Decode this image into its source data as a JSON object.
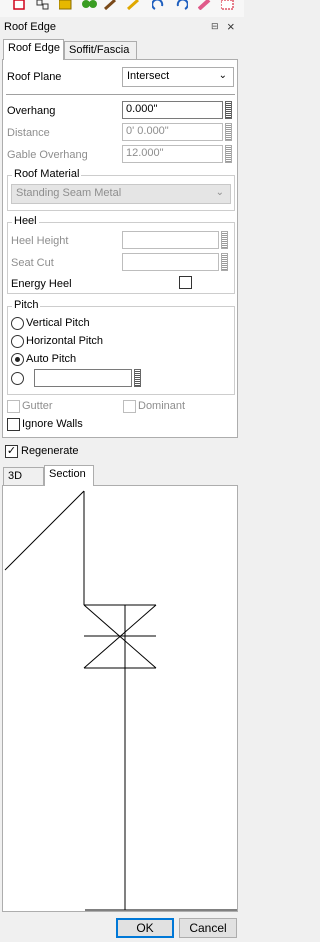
{
  "toolbar": {
    "icons": [
      "new-file-icon",
      "nodes-icon",
      "folder-lock-icon",
      "trees-icon",
      "brush-icon",
      "pencil-icon",
      "undo-icon",
      "redo-icon",
      "eraser-icon",
      "grid-icon"
    ]
  },
  "window": {
    "title": "Roof Edge",
    "pin_glyph": "⊟",
    "close_glyph": "×"
  },
  "tabs_top": [
    {
      "label": "Roof Edge",
      "active": true
    },
    {
      "label": "Soffit/Fascia",
      "active": false
    }
  ],
  "form": {
    "roof_plane_label": "Roof Plane",
    "roof_plane_value": "Intersect",
    "overhang_label": "Overhang",
    "overhang_value": "0.000\"",
    "distance_label": "Distance",
    "distance_value": "0' 0.000\"",
    "gable_overhang_label": "Gable Overhang",
    "gable_overhang_value": "12.000\""
  },
  "roof_material": {
    "title": "Roof Material",
    "value": "Standing Seam Metal"
  },
  "heel": {
    "title": "Heel",
    "heel_height_label": "Heel Height",
    "heel_height_value": "",
    "seat_cut_label": "Seat Cut",
    "seat_cut_value": "",
    "energy_heel_label": "Energy Heel",
    "energy_heel_checked": false
  },
  "pitch": {
    "title": "Pitch",
    "options": [
      {
        "label": "Vertical Pitch",
        "selected": false
      },
      {
        "label": "Horizontal Pitch",
        "selected": false
      },
      {
        "label": "Auto Pitch",
        "selected": true
      }
    ],
    "custom_value": ""
  },
  "checks": {
    "gutter_label": "Gutter",
    "gutter_checked": false,
    "dominant_label": "Dominant",
    "dominant_checked": false,
    "ignore_walls_label": "Ignore Walls",
    "ignore_walls_checked": false
  },
  "regenerate": {
    "label": "Regenerate",
    "checked": true,
    "check_glyph": "✓"
  },
  "tabs_bottom": [
    {
      "label": "3D",
      "active": false
    },
    {
      "label": "Section",
      "active": true
    }
  ],
  "buttons": {
    "ok": "OK",
    "cancel": "Cancel"
  },
  "glyphs": {
    "chevron": "⌄"
  }
}
